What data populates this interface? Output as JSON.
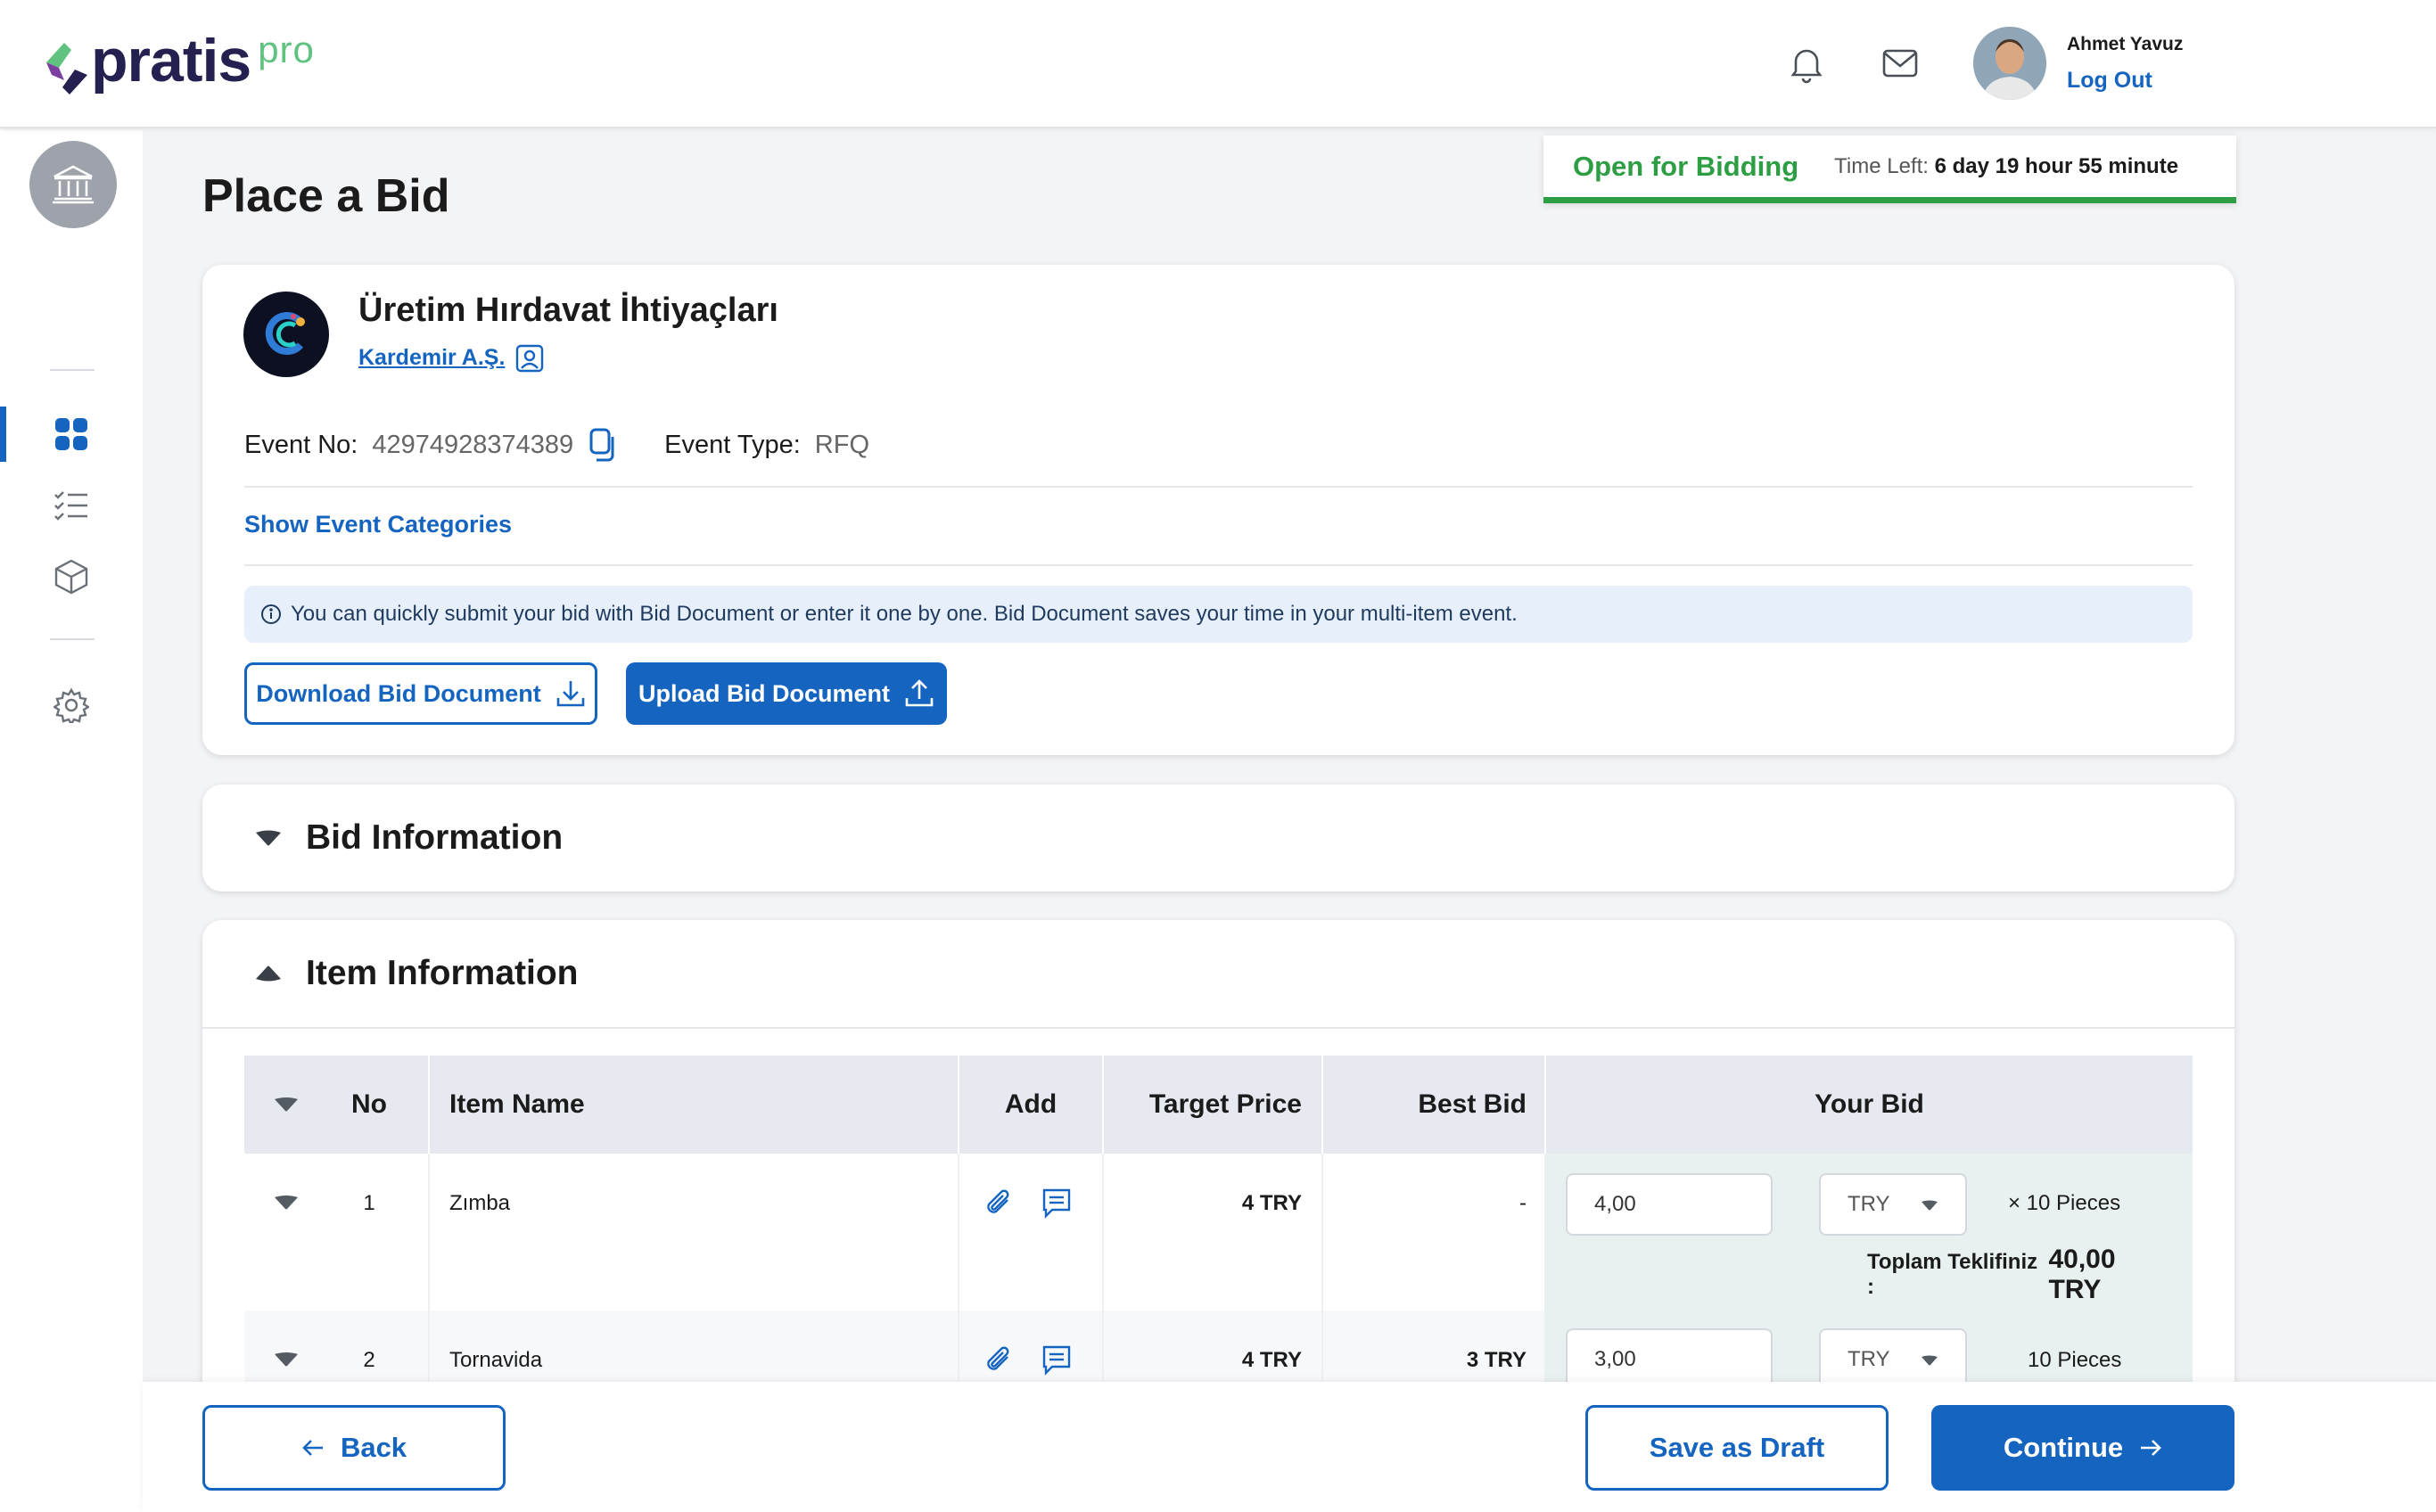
{
  "brand": {
    "name": "pratis",
    "suffix": "pro"
  },
  "user": {
    "name": "Ahmet Yavuz",
    "logout_label": "Log Out"
  },
  "page": {
    "title": "Place a Bid"
  },
  "status": {
    "label": "Open for Bidding",
    "time_left_label": "Time Left:",
    "time_left_value": "6 day 19 hour 55 minute"
  },
  "event": {
    "title": "Üretim Hırdavat İhtiyaçları",
    "company": "Kardemir A.Ş.",
    "event_no_label": "Event No:",
    "event_no": "42974928374389",
    "event_type_label": "Event Type:",
    "event_type": "RFQ",
    "show_categories": "Show Event Categories",
    "info_text": "You can quickly submit your bid with Bid Document or enter it one by one. Bid Document saves your time in your multi-item event.",
    "download_label": "Download Bid Document",
    "upload_label": "Upload Bid Document"
  },
  "sections": {
    "bid_info": "Bid Information",
    "item_info": "Item Information"
  },
  "table": {
    "headers": {
      "no": "No",
      "item_name": "Item Name",
      "add": "Add",
      "target_price": "Target Price",
      "best_bid": "Best Bid",
      "your_bid": "Your Bid"
    },
    "rows": [
      {
        "no": "1",
        "name": "Zımba",
        "target": "4 TRY",
        "best": "-",
        "bid": "4,00",
        "currency": "TRY",
        "qty": "× 10 Pieces",
        "total_label": "Toplam Teklifiniz :",
        "total_value": "40,00 TRY"
      },
      {
        "no": "2",
        "name": "Tornavida",
        "target": "4 TRY",
        "best": "3 TRY",
        "bid": "3,00",
        "currency": "TRY",
        "qty": "10 Pieces"
      }
    ]
  },
  "footer": {
    "back": "Back",
    "save_draft": "Save as Draft",
    "continue": "Continue"
  },
  "colors": {
    "primary": "#1565c0",
    "success": "#2e9e45",
    "brand_dark": "#24204f",
    "brand_green": "#5fc27e"
  }
}
